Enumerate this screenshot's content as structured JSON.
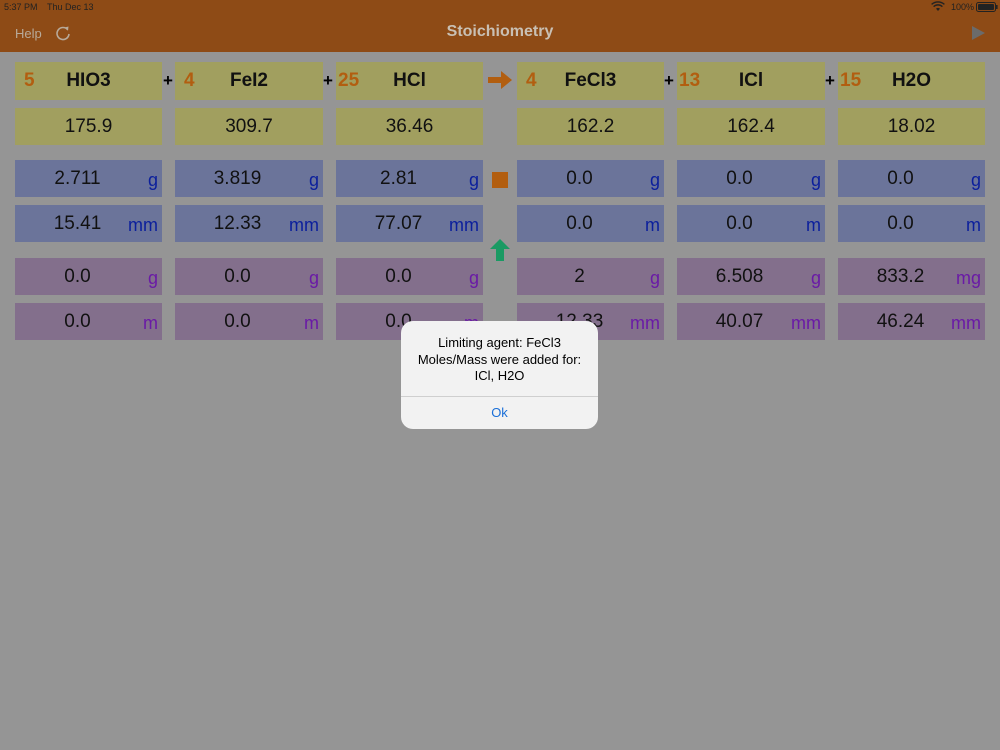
{
  "status": {
    "time": "5:37 PM",
    "date": "Thu Dec 13",
    "battery": "100%"
  },
  "nav": {
    "title": "Stoichiometry",
    "help": "Help"
  },
  "plus": "+",
  "reactants": [
    {
      "coef": "5",
      "formula": "HIO3",
      "molar_mass": "175.9",
      "mass": "2.711",
      "mass_unit": "g",
      "moles": "15.41",
      "moles_unit": "mm",
      "res_mass": "0.0",
      "res_mass_unit": "g",
      "res_moles": "0.0",
      "res_moles_unit": "m"
    },
    {
      "coef": "4",
      "formula": "FeI2",
      "molar_mass": "309.7",
      "mass": "3.819",
      "mass_unit": "g",
      "moles": "12.33",
      "moles_unit": "mm",
      "res_mass": "0.0",
      "res_mass_unit": "g",
      "res_moles": "0.0",
      "res_moles_unit": "m"
    },
    {
      "coef": "25",
      "formula": "HCl",
      "molar_mass": "36.46",
      "mass": "2.81",
      "mass_unit": "g",
      "moles": "77.07",
      "moles_unit": "mm",
      "res_mass": "0.0",
      "res_mass_unit": "g",
      "res_moles": "0.0",
      "res_moles_unit": "m"
    }
  ],
  "products": [
    {
      "coef": "4",
      "formula": "FeCl3",
      "molar_mass": "162.2",
      "mass": "0.0",
      "mass_unit": "g",
      "moles": "0.0",
      "moles_unit": "m",
      "res_mass": "2",
      "res_mass_unit": "g",
      "res_moles": "12.33",
      "res_moles_unit": "mm"
    },
    {
      "coef": "13",
      "formula": "ICl",
      "molar_mass": "162.4",
      "mass": "0.0",
      "mass_unit": "g",
      "moles": "0.0",
      "moles_unit": "m",
      "res_mass": "6.508",
      "res_mass_unit": "g",
      "res_moles": "40.07",
      "res_moles_unit": "mm"
    },
    {
      "coef": "15",
      "formula": "H2O",
      "molar_mass": "18.02",
      "mass": "0.0",
      "mass_unit": "g",
      "moles": "0.0",
      "moles_unit": "m",
      "res_mass": "833.2",
      "res_mass_unit": "mg",
      "res_moles": "46.24",
      "res_moles_unit": "mm"
    }
  ],
  "colors": {
    "orange": "#b25e10",
    "green": "#1a9a63"
  },
  "dialog": {
    "line1": "Limiting agent: FeCl3",
    "line2": "Moles/Mass were added for:",
    "line3": "ICl, H2O",
    "ok": "Ok"
  }
}
